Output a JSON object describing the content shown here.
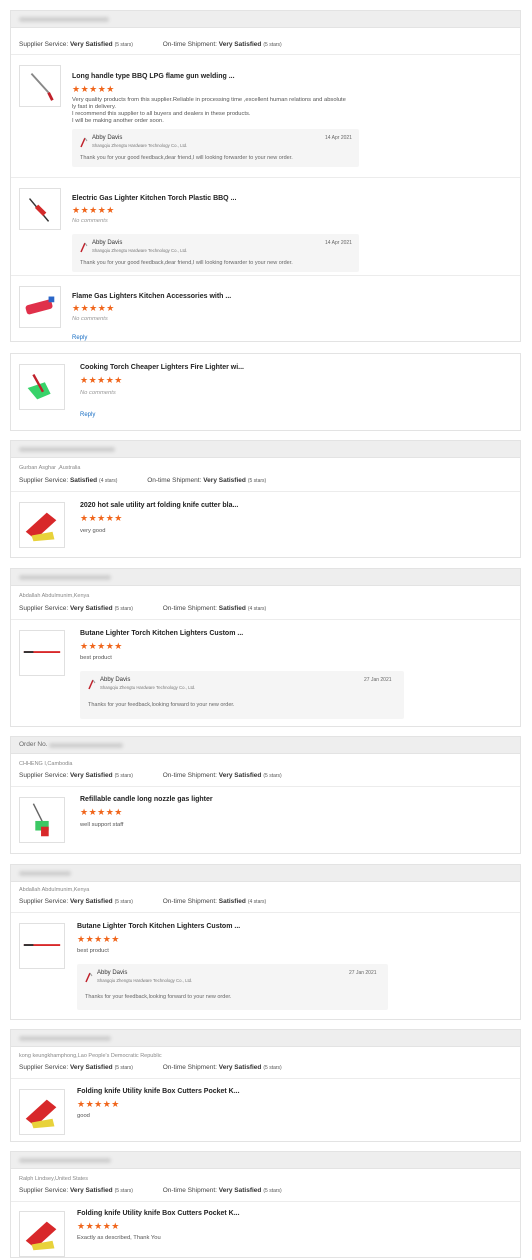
{
  "colors": {
    "star": "#f0651b",
    "link": "#1a6fc4",
    "header_bg": "#eeeeee"
  },
  "stars": "★★★★★",
  "labels": {
    "supplier_service": "Supplier Service:",
    "ontime_shipment": "On-time Shipment:",
    "reply": "Reply",
    "no_comments": "No comments",
    "order_no": "Order No."
  },
  "seller": {
    "name": "Abby Davis",
    "company": "Shangqiu Zhengtu Hardware Technology Co., Ltd."
  },
  "card1": {
    "supplier_rating": "Very Satisfied",
    "supplier_stars": "(5 stars)",
    "shipment_rating": "Very Satisfied",
    "shipment_stars": "(5 stars)",
    "items": [
      {
        "title": "Long handle type BBQ LPG flame gun welding ...",
        "comment_lines": [
          "Very quality products from this supplier.Reliable in processing time ,excellent human relations and absolute",
          "ly fast in delivery.",
          "I recommend this supplier to all buyers and dealers in these products.",
          "I will be making another order soon."
        ],
        "reply_date": "14 Apr 2021",
        "reply_text": "Thank you for your good feedback,dear friend,I will looking forwarder to your new order."
      },
      {
        "title": "Electric Gas Lighter Kitchen Torch Plastic BBQ ...",
        "reply_date": "14 Apr 2021",
        "reply_text": "Thank you for your good feedback,dear friend,I will looking forwarder to your new order."
      },
      {
        "title": "Flame Gas Lighters Kitchen Accessories with ..."
      }
    ]
  },
  "card2": {
    "item": {
      "title": "Cooking Torch Cheaper Lighters Fire Lighter wi..."
    }
  },
  "card3": {
    "buyer": "Gurban Asghar ,Australia",
    "supplier_rating": "Satisfied",
    "supplier_stars": "(4 stars)",
    "shipment_rating": "Very Satisfied",
    "shipment_stars": "(5 stars)",
    "item": {
      "title": "2020 hot sale utility art folding knife cutter bla...",
      "comment": "very good"
    }
  },
  "card4": {
    "buyer": "Abdallah Abdulmunim,Kenya",
    "supplier_rating": "Very Satisfied",
    "supplier_stars": "(5 stars)",
    "shipment_rating": "Satisfied",
    "shipment_stars": "(4 stars)",
    "item": {
      "title": "Butane Lighter Torch Kitchen Lighters Custom ...",
      "comment": "best product",
      "reply_date": "27 Jan 2021",
      "reply_text": "Thanks for your feedback,looking forward to your new order."
    }
  },
  "card5": {
    "buyer": "CHHENG I,Cambodia",
    "supplier_rating": "Very Satisfied",
    "supplier_stars": "(5 stars)",
    "shipment_rating": "Very Satisfied",
    "shipment_stars": "(5 stars)",
    "item": {
      "title": "Refillable candle long nozzle gas lighter",
      "comment": "well support staff"
    }
  },
  "card6": {
    "buyer": "Abdallah Abdulmunim,Kenya",
    "supplier_rating": "Very Satisfied",
    "supplier_stars": "(5 stars)",
    "shipment_rating": "Satisfied",
    "shipment_stars": "(4 stars)",
    "item": {
      "title": "Butane Lighter Torch Kitchen Lighters Custom ...",
      "comment": "best product",
      "reply_date": "27 Jan 2021",
      "reply_text": "Thanks for your feedback,looking forward to your new order."
    }
  },
  "card7": {
    "buyer": "kong keungkhamphong,Lao People's Democratic Republic",
    "supplier_rating": "Very Satisfied",
    "supplier_stars": "(5 stars)",
    "shipment_rating": "Very Satisfied",
    "shipment_stars": "(5 stars)",
    "item": {
      "title": "Folding knife Utility knife Box Cutters Pocket K...",
      "comment": "good"
    }
  },
  "card8": {
    "buyer": "Ralph Lindsey,United States",
    "supplier_rating": "Very Satisfied",
    "supplier_stars": "(5 stars)",
    "shipment_rating": "Very Satisfied",
    "shipment_stars": "(5 stars)",
    "item": {
      "title": "Folding knife Utility knife Box Cutters Pocket K...",
      "comment": "Exactly as described, Thank You"
    }
  }
}
